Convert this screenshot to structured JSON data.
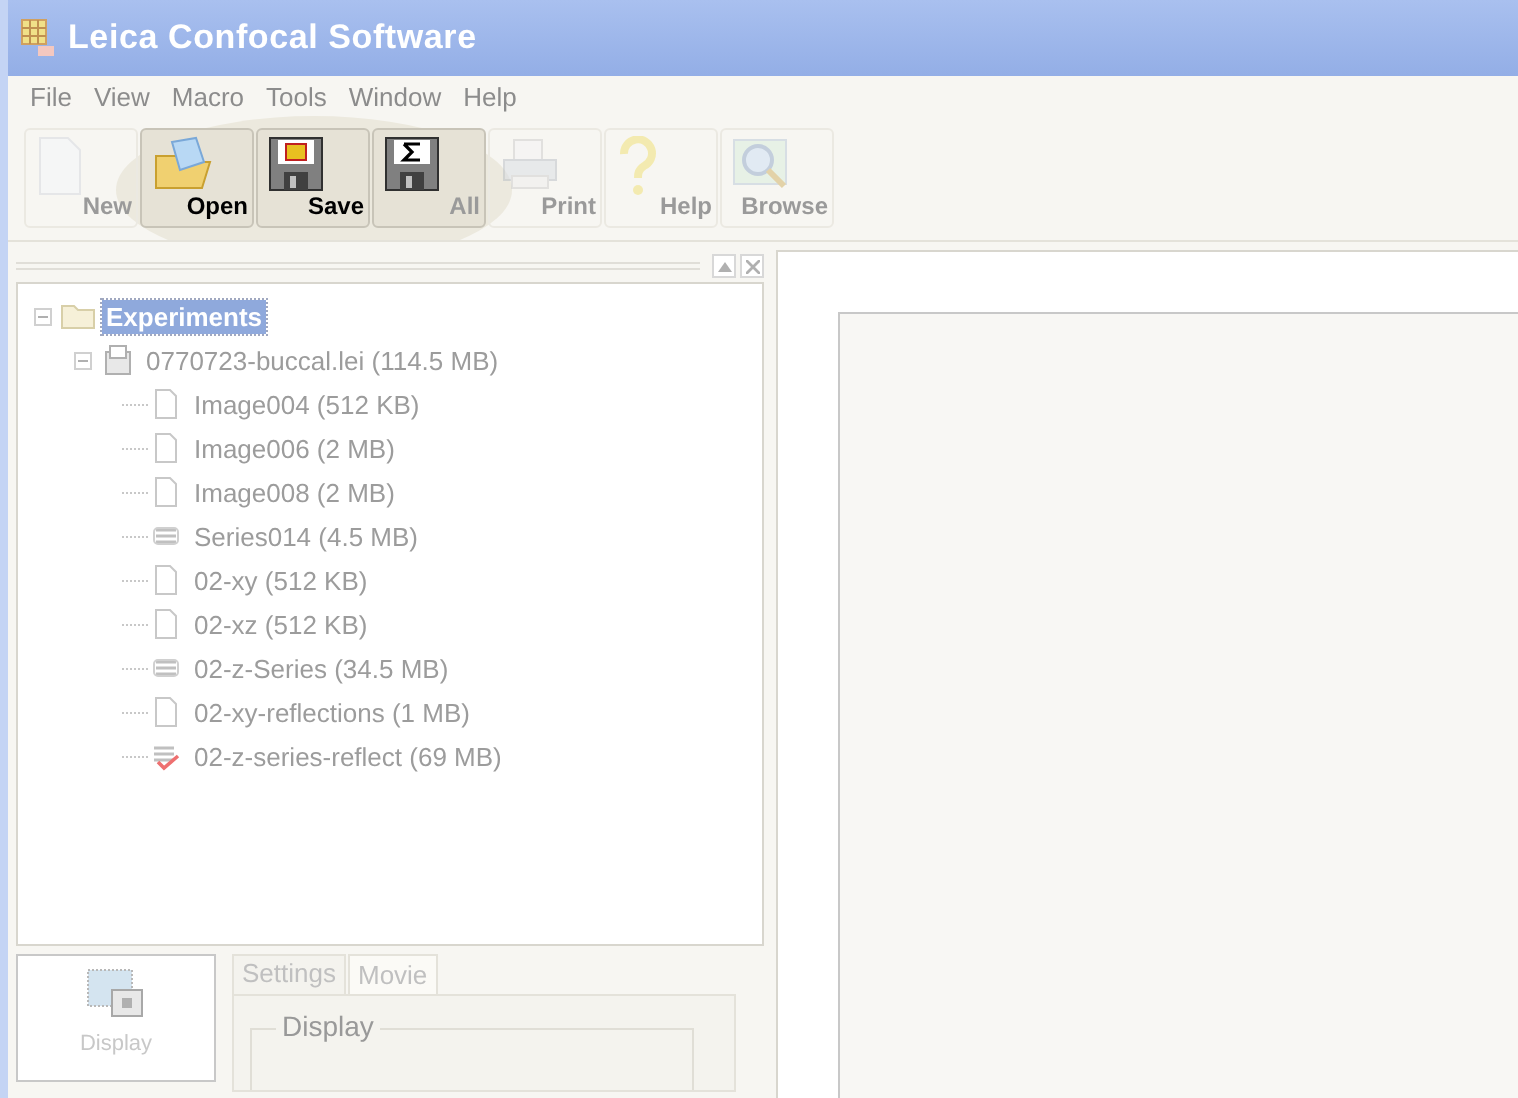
{
  "window": {
    "title": "Leica Confocal Software"
  },
  "menu": [
    {
      "label": "File"
    },
    {
      "label": "View"
    },
    {
      "label": "Macro"
    },
    {
      "label": "Tools"
    },
    {
      "label": "Window"
    },
    {
      "label": "Help"
    }
  ],
  "toolbar": [
    {
      "label": "New",
      "kind": "new",
      "disabled": true,
      "highlighted": false
    },
    {
      "label": "Open",
      "kind": "open",
      "disabled": false,
      "highlighted": true
    },
    {
      "label": "Save",
      "kind": "save",
      "disabled": false,
      "highlighted": true
    },
    {
      "label": "All",
      "kind": "save-all",
      "disabled": true,
      "highlighted": true
    },
    {
      "label": "Print",
      "kind": "print",
      "disabled": true,
      "highlighted": false
    },
    {
      "label": "Help",
      "kind": "help",
      "disabled": true,
      "highlighted": false
    },
    {
      "label": "Browse",
      "kind": "browse",
      "disabled": true,
      "highlighted": false
    }
  ],
  "tree": [
    {
      "label": "Experiments",
      "kind": "folder",
      "selected": true,
      "expanded": true,
      "children": [
        {
          "label": "0770723-buccal.lei (114.5 MB)",
          "kind": "file",
          "selected": false,
          "expanded": true,
          "children": [
            {
              "label": "Image004 (512 KB)",
              "kind": "image",
              "selected": false
            },
            {
              "label": "Image006 (2 MB)",
              "kind": "image",
              "selected": false
            },
            {
              "label": "Image008 (2 MB)",
              "kind": "image",
              "selected": false
            },
            {
              "label": "Series014 (4.5 MB)",
              "kind": "series",
              "selected": false
            },
            {
              "label": "02-xy (512 KB)",
              "kind": "image",
              "selected": false
            },
            {
              "label": "02-xz (512 KB)",
              "kind": "image",
              "selected": false
            },
            {
              "label": "02-z-Series (34.5 MB)",
              "kind": "series",
              "selected": false
            },
            {
              "label": "02-xy-reflections (1 MB)",
              "kind": "image",
              "selected": false
            },
            {
              "label": "02-z-series-reflect (69 MB)",
              "kind": "series-checked",
              "selected": false
            }
          ]
        }
      ]
    }
  ],
  "display_button": {
    "label": "Display"
  },
  "tabs": [
    {
      "label": "Settings",
      "selected": true
    },
    {
      "label": "Movie",
      "selected": false
    }
  ],
  "group": {
    "title": "Display"
  }
}
